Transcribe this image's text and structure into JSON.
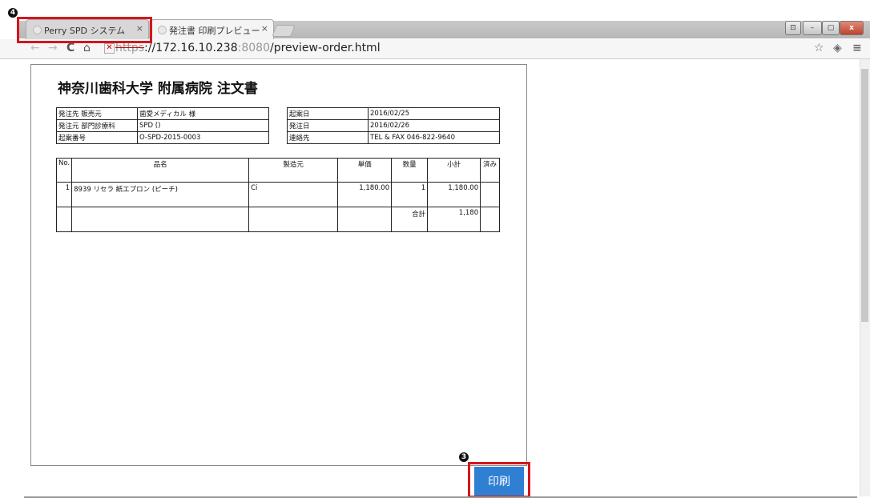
{
  "annotations": {
    "tab_marker": "4",
    "print_marker": "3"
  },
  "browser": {
    "tabs": [
      {
        "title": "Perry SPD システム",
        "close": "×"
      },
      {
        "title": "発注書 印刷プレビュー",
        "close": "×"
      }
    ],
    "window_controls": {
      "minimize": "–",
      "restore": "▢",
      "close": "x"
    },
    "url": {
      "scheme": "https",
      "rest": "://172.16.10.238",
      "port": ":8080",
      "path": "/preview-order.html"
    },
    "icons": [
      "back-icon",
      "forward-icon",
      "reload-icon",
      "home-icon",
      "ssl-warning-icon",
      "star-icon",
      "extension-icon",
      "menu-icon"
    ]
  },
  "document": {
    "title": "神奈川歯科大学 附属病院 注文書",
    "info_left": [
      {
        "label": "発注先 販売元",
        "value": "歯愛メディカル 様"
      },
      {
        "label": "発注元 部門診療科",
        "value": "SPD ()"
      },
      {
        "label": "起案番号",
        "value": "O-SPD-2015-0003"
      }
    ],
    "info_right": [
      {
        "label": "起案日",
        "value": "2016/02/25"
      },
      {
        "label": "発注日",
        "value": "2016/02/26"
      },
      {
        "label": "連絡先",
        "value": "TEL & FAX 046-822-9640"
      }
    ],
    "items_headers": [
      "No.",
      "品名",
      "製造元",
      "単価",
      "数量",
      "小計",
      "済み"
    ],
    "items": [
      {
        "no": "1",
        "name": "8939 リセラ 紙エプロン (ピーチ)",
        "maker": "Ci",
        "unit_price": "1,180.00",
        "qty": "1",
        "subtotal": "1,180.00",
        "done": ""
      }
    ],
    "total_label": "合計",
    "total_value": "1,180"
  },
  "print_button": {
    "label": "印刷"
  },
  "colors": {
    "print_button": "#2f7fd3",
    "highlight": "#d4161d"
  }
}
